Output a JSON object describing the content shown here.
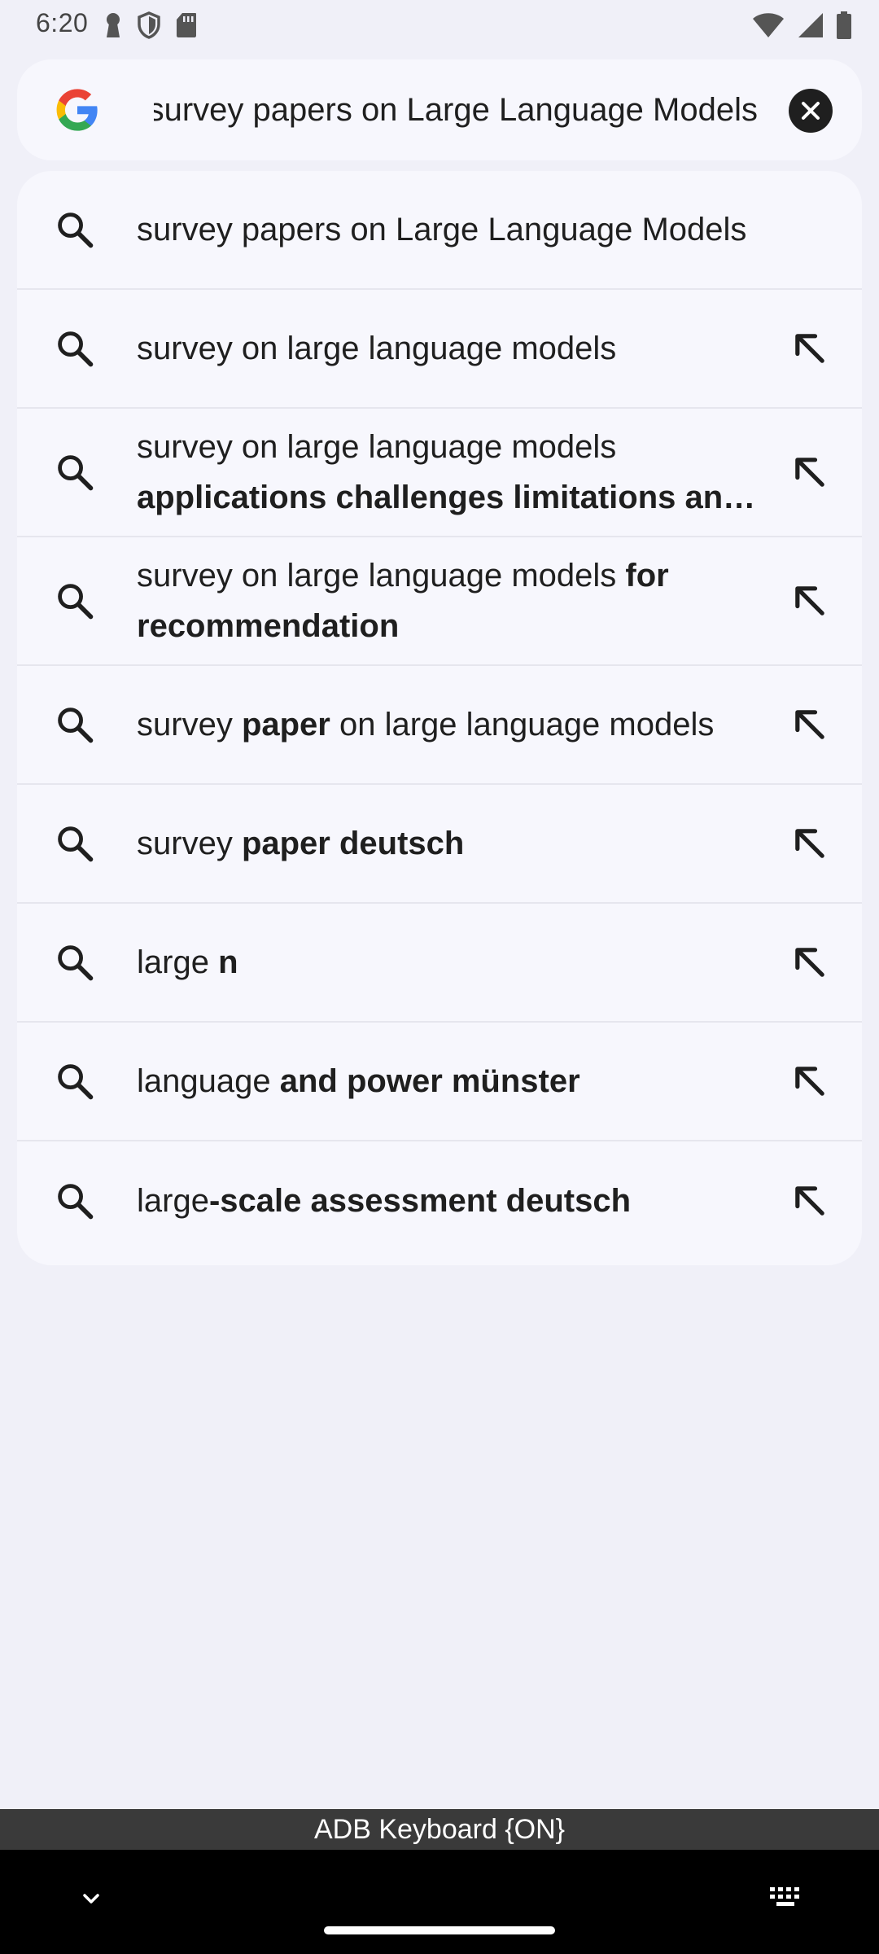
{
  "status_bar": {
    "time": "6:20",
    "left_icons": [
      "keyhole-icon",
      "shield-icon",
      "sd-card-icon"
    ],
    "right_icons": [
      "wifi-icon",
      "signal-icon",
      "battery-icon"
    ]
  },
  "search": {
    "logo": "google-g-logo",
    "query": "survey papers on Large Language Models",
    "clear_icon": "close-icon"
  },
  "suggestions": [
    {
      "query": "survey papers on Large Language Models",
      "completion": "",
      "action_icon": ""
    },
    {
      "query": "survey on large language models",
      "completion": "",
      "action_icon": "arrow-up-left-icon"
    },
    {
      "query": "survey on large language models",
      "completion": "applications challenges limitations an…",
      "action_icon": "arrow-up-left-icon"
    },
    {
      "query": "survey on large language models",
      "completion_inline": "for",
      "completion": "recommendation",
      "action_icon": "arrow-up-left-icon"
    },
    {
      "query_prefix": "survey",
      "completion_inline": "paper",
      "query_suffix": "on large language models",
      "action_icon": "arrow-up-left-icon"
    },
    {
      "query": "survey",
      "completion": "paper deutsch",
      "action_icon": "arrow-up-left-icon"
    },
    {
      "query": "large",
      "completion": "n",
      "action_icon": "arrow-up-left-icon"
    },
    {
      "query": "language",
      "completion": "and power münster",
      "action_icon": "arrow-up-left-icon"
    },
    {
      "query": "large",
      "completion": "-scale assessment deutsch",
      "action_icon": "arrow-up-left-icon"
    }
  ],
  "keyboard": {
    "label": "ADB Keyboard {ON}"
  },
  "nav": {
    "back_icon": "chevron-down-icon",
    "keyboard_icon": "keyboard-icon"
  },
  "colors": {
    "background": "#f0f0f8",
    "card": "#f7f7fd",
    "text": "#1f1f1f",
    "keyboard_bar": "#3a3a3a"
  }
}
